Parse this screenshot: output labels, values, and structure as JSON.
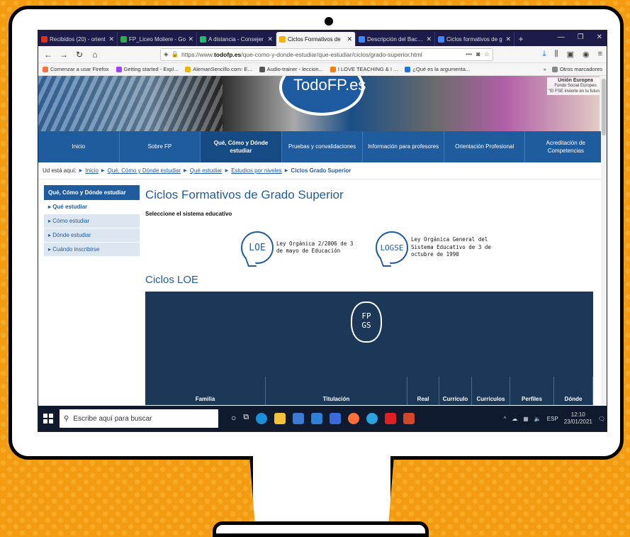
{
  "browser": {
    "tabs": [
      {
        "title": "Recibidos (20) - orient",
        "color": "#d93025"
      },
      {
        "title": "FP_Liceo Moliere - Go",
        "color": "#34a853"
      },
      {
        "title": "A distancia - Consejer",
        "color": "#2bb673"
      },
      {
        "title": "Ciclos Formativos de",
        "color": "#f4b400",
        "active": true
      },
      {
        "title": "Descripción del Bachill",
        "color": "#4285f4"
      },
      {
        "title": "Ciclos formativos de g",
        "color": "#4285f4"
      }
    ],
    "url_prefix": "https://www.",
    "url_domain": "todofp.es",
    "url_path": "/que-como-y-donde-estudiar/que-estudiar/ciclos/grado-superior.html",
    "bookmarks": [
      "Comenzar a usar Firefox",
      "Getting started - Expl...",
      "AlemanSencillo.com: E...",
      "Audio-trainer - leccion...",
      "I LOVE TEACHING & I ...",
      "¿Qué es la argumenta..."
    ],
    "bookmarks_more": "Otros marcadores"
  },
  "site": {
    "logo": "TodoFP.es",
    "ue_title": "Unión Europea",
    "ue_sub1": "Fondo Social Europeo",
    "ue_sub2": "\"El FSE invierte en tu futuro\"",
    "nav": [
      "Inicio",
      "Sobre FP",
      "Qué, Cómo y Dónde estudiar",
      "Pruebas y convalidaciones",
      "Información para profesores",
      "Orientación Profesional",
      "Acreditación de Competencias"
    ],
    "crumb_label": "Ud está aquí:",
    "crumbs": [
      "Inicio",
      "Qué, Cómo y Dónde estudiar",
      "Qué estudiar",
      "Estudios por niveles"
    ],
    "crumb_current": "Ciclos Grado Superior",
    "sidebar_head": "Qué, Cómo y Dónde estudiar",
    "sidebar_items": [
      "Qué estudiar",
      "Cómo estudiar",
      "Dónde estudiar",
      "Cuándo inscribirse"
    ],
    "page_title": "Ciclos Formativos de Grado Superior",
    "select_prompt": "Seleccione el sistema educativo",
    "loe_badge": "LOE",
    "loe_text": "Ley Orgánica 2/2006 de 3 de mayo de Educación",
    "logse_badge": "LOGSE",
    "logse_text": "Ley Orgánica General del Sistema Educativo de 3 de octubre de 1990",
    "section_title": "Ciclos LOE",
    "fp_badge_top": "FP",
    "fp_badge_bottom": "GS",
    "table_headers": [
      "Familia",
      "Titulación",
      "Real",
      "Currículo",
      "Currículos",
      "Perfiles",
      "Dónde"
    ]
  },
  "taskbar": {
    "search_placeholder": "Escribe aquí para buscar",
    "lang": "ESP",
    "time": "12:10",
    "date": "23/01/2021"
  }
}
